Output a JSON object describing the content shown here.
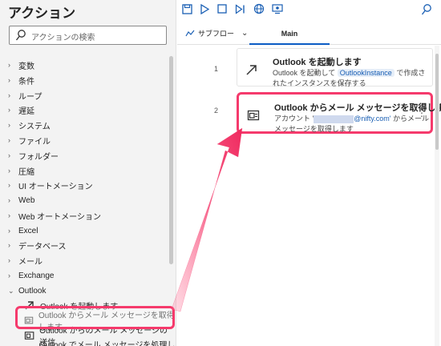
{
  "left_panel": {
    "title": "アクション",
    "search_placeholder": "アクションの検索",
    "categories": [
      {
        "label": "変数"
      },
      {
        "label": "条件"
      },
      {
        "label": "ループ"
      },
      {
        "label": "遅延"
      },
      {
        "label": "システム"
      },
      {
        "label": "ファイル"
      },
      {
        "label": "フォルダー"
      },
      {
        "label": "圧縮"
      },
      {
        "label": "UI オートメーション"
      },
      {
        "label": "Web"
      },
      {
        "label": "Web オートメーション"
      },
      {
        "label": "Excel"
      },
      {
        "label": "データベース"
      },
      {
        "label": "メール"
      },
      {
        "label": "Exchange"
      },
      {
        "label": "Outlook",
        "expanded": true
      }
    ],
    "outlook_items": [
      {
        "label": "Outlook を起動します"
      },
      {
        "label": "Outlook からメール メッセージを取得します"
      },
      {
        "label": "Outlook からのメール メッセージの送信"
      },
      {
        "label": "Outlook でメール メッセージを処理します"
      }
    ]
  },
  "toolbar": {
    "icons": [
      "save-icon",
      "run-icon",
      "stop-icon",
      "next-step-icon",
      "web-recorder-icon",
      "desktop-recorder-icon"
    ],
    "search_icon": "search-icon"
  },
  "tabs": {
    "subflow_label": "サブフロー",
    "main_label": "Main"
  },
  "flow": {
    "steps": [
      {
        "line": "1",
        "title": "Outlook を起動します",
        "desc_pre": "Outlook を起動して",
        "variable": "OutlookInstance",
        "desc_post": "で作成されたインスタンスを保存する"
      },
      {
        "line": "2",
        "title": "Outlook からメール メッセージを取得します",
        "desc_pre": "アカウント '",
        "email_visible": "@nifty.com'",
        "desc_post": "からメール メッセージを取得します"
      }
    ]
  },
  "colors": {
    "highlight": "#f53a6c",
    "accent": "#0b5cc4",
    "variable_bg": "#e6eef8"
  }
}
